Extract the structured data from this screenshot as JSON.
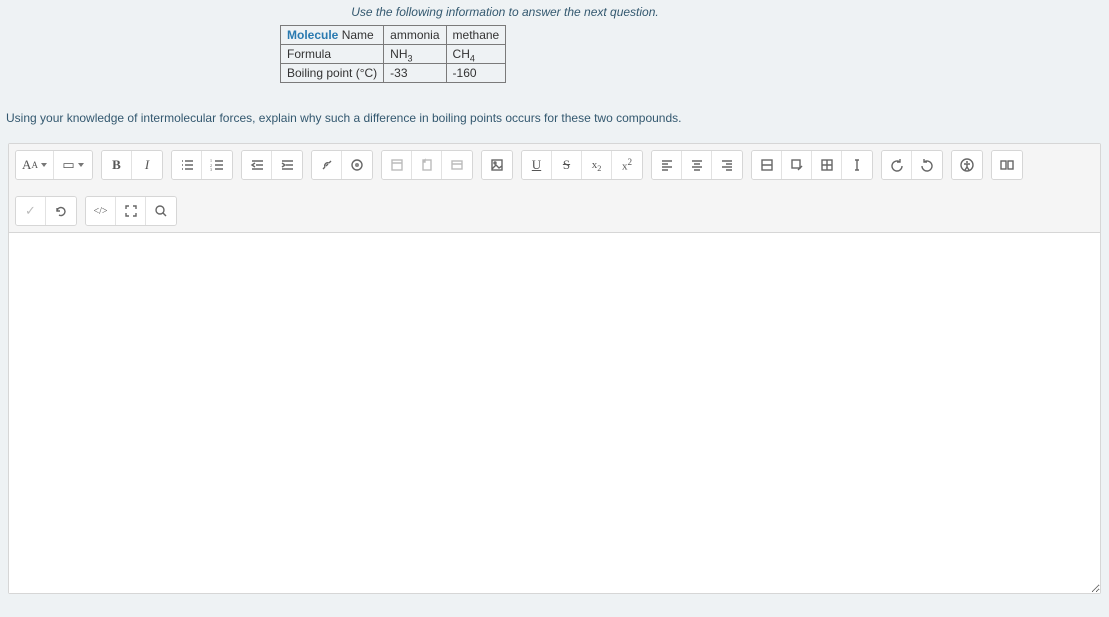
{
  "caption": "Use the following information to answer the next question.",
  "table": {
    "header": {
      "label_html": "Molecule Name",
      "col1": "ammonia",
      "col2": "methane"
    },
    "rows": [
      {
        "label": "Formula",
        "col1_html": "NH<sub>3</sub>",
        "col2_html": "CH<sub>4</sub>"
      },
      {
        "label": "Boiling point (°C)",
        "col1": "-33",
        "col2": "-160"
      }
    ]
  },
  "prompt": "Using your knowledge of intermolecular forces, explain why such a difference in boiling points occurs for these two compounds.",
  "toolbar": {
    "row1": [
      {
        "group": [
          {
            "name": "font-family-dropdown",
            "html": "A<span style='font-size:9px;vertical-align:sub'>A</span>",
            "caret": true
          },
          {
            "name": "font-size-dropdown",
            "html": "▭",
            "caret": true
          }
        ]
      },
      {
        "group": [
          {
            "name": "bold-button",
            "html": "<b style='font-family:Georgia'>B</b>"
          },
          {
            "name": "italic-button",
            "html": "<i style='font-family:Georgia'>I</i>"
          }
        ]
      },
      {
        "group": [
          {
            "name": "unordered-list-button",
            "svg": "ul"
          },
          {
            "name": "ordered-list-button",
            "svg": "ol"
          }
        ]
      },
      {
        "group": [
          {
            "name": "outdent-button",
            "svg": "outdent"
          },
          {
            "name": "indent-button",
            "svg": "indent"
          }
        ]
      },
      {
        "group": [
          {
            "name": "link-button",
            "svg": "link"
          },
          {
            "name": "record-button",
            "svg": "record"
          }
        ]
      },
      {
        "group": [
          {
            "name": "embed-content-button",
            "svg": "embed",
            "disabled": true
          },
          {
            "name": "insert-file-button",
            "svg": "file",
            "disabled": true
          },
          {
            "name": "insert-attachment-button",
            "svg": "attach",
            "disabled": true
          }
        ]
      },
      {
        "group": [
          {
            "name": "insert-image-button",
            "svg": "image"
          }
        ]
      },
      {
        "group": [
          {
            "name": "underline-button",
            "html": "<u style='font-family:Georgia'>U</u>"
          },
          {
            "name": "strikethrough-button",
            "html": "<s style='font-family:Georgia'>S</s>"
          },
          {
            "name": "subscript-button",
            "html": "<span class='xsub'>x<sub>2</sub></span>"
          },
          {
            "name": "superscript-button",
            "html": "<span class='xsup'>x<sup>2</sup></span>"
          }
        ]
      },
      {
        "group": [
          {
            "name": "align-left-button",
            "svg": "alignl"
          },
          {
            "name": "align-center-button",
            "svg": "alignc"
          },
          {
            "name": "align-right-button",
            "svg": "alignr"
          }
        ]
      },
      {
        "group": [
          {
            "name": "insert-table-row-button",
            "svg": "tablerow"
          },
          {
            "name": "edit-table-button",
            "svg": "tableedit"
          },
          {
            "name": "insert-table-button",
            "svg": "tablegrid"
          },
          {
            "name": "text-cursor-button",
            "svg": "cursor"
          }
        ]
      },
      {
        "group": [
          {
            "name": "undo-button",
            "svg": "undo"
          },
          {
            "name": "redo-button",
            "svg": "redo"
          }
        ]
      },
      {
        "group": [
          {
            "name": "accessibility-button",
            "svg": "a11y"
          }
        ]
      },
      {
        "group": [
          {
            "name": "html-block-button",
            "svg": "htmlblock"
          }
        ]
      }
    ],
    "row2": [
      {
        "group": [
          {
            "name": "spellcheck-button",
            "html": "<span style='color:#bbb'>✓</span>",
            "disabled": true
          },
          {
            "name": "refresh-button",
            "svg": "refresh"
          }
        ]
      },
      {
        "group": [
          {
            "name": "code-view-button",
            "html": "<span style='font-size:10px'>&lt;/&gt;</span>"
          },
          {
            "name": "fullscreen-button",
            "svg": "fullscreen"
          },
          {
            "name": "zoom-button",
            "svg": "zoom"
          }
        ]
      }
    ]
  },
  "editor": {
    "value": ""
  }
}
